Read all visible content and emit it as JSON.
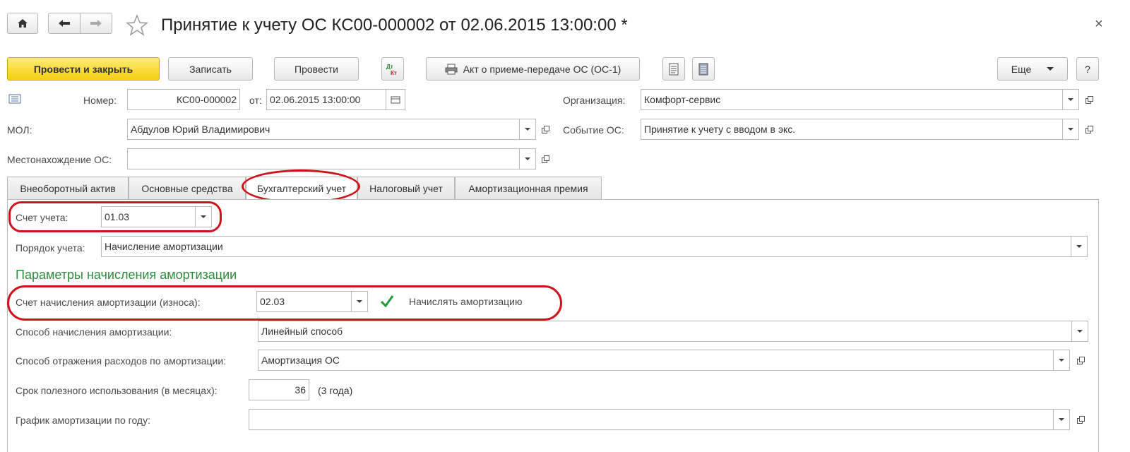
{
  "title": "Принятие к учету ОС КС00-000002 от 02.06.2015 13:00:00 *",
  "toolbar": {
    "post_close": "Провести и закрыть",
    "save": "Записать",
    "post": "Провести",
    "act": "Акт о приеме-передаче ОС (ОС-1)",
    "more": "Еще",
    "help": "?"
  },
  "header": {
    "number_label": "Номер:",
    "number_value": "КС00-000002",
    "date_label": "от:",
    "date_value": "02.06.2015 13:00:00",
    "org_label": "Организация:",
    "org_value": "Комфорт-сервис",
    "mol_label": "МОЛ:",
    "mol_value": "Абдулов Юрий Владимирович",
    "event_label": "Событие ОС:",
    "event_value": "Принятие к учету с вводом в экс.",
    "location_label": "Местонахождение ОС:",
    "location_value": ""
  },
  "tabs": [
    {
      "label": "Внеоборотный актив"
    },
    {
      "label": "Основные средства"
    },
    {
      "label": "Бухгалтерский учет"
    },
    {
      "label": "Налоговый учет"
    },
    {
      "label": "Амортизационная премия"
    }
  ],
  "accounting": {
    "account_label": "Счет учета:",
    "account_value": "01.03",
    "order_label": "Порядок учета:",
    "order_value": "Начисление амортизации",
    "section_title": "Параметры начисления амортизации",
    "depr_account_label": "Счет начисления амортизации (износа):",
    "depr_account_value": "02.03",
    "accrue_checkbox_label": "Начислять амортизацию",
    "accrue_checked": true,
    "method_label": "Способ начисления амортизации:",
    "method_value": "Линейный способ",
    "expense_label": "Способ отражения расходов по амортизации:",
    "expense_value": "Амортизация ОС",
    "term_label": "Срок полезного использования (в месяцах):",
    "term_value": "36",
    "term_note": "(3 года)",
    "schedule_label": "График амортизации по году:",
    "schedule_value": ""
  },
  "colors": {
    "accent_yellow": "#f5cf12",
    "section_green": "#2e8b3c",
    "highlight_red": "#d0121b",
    "checkmark_green": "#1f9a3a"
  }
}
